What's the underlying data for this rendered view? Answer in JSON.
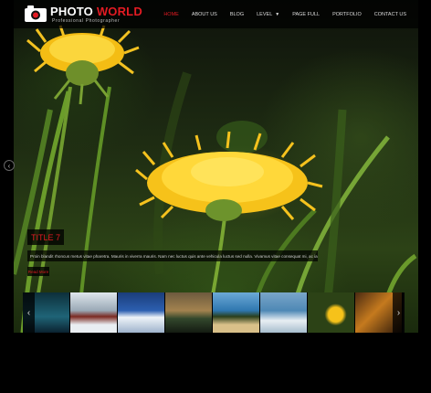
{
  "header": {
    "brand_primary": "PHOTO",
    "brand_accent": "WORLD",
    "tagline": "Professional Photographer",
    "logo_icon": "camera-icon"
  },
  "nav": {
    "items": [
      {
        "label": "HOME",
        "active": true
      },
      {
        "label": "ABOUT US",
        "active": false
      },
      {
        "label": "BLOG",
        "active": false
      },
      {
        "label": "LEVEL",
        "active": false,
        "has_submenu": true
      },
      {
        "label": "PAGE FULL",
        "active": false
      },
      {
        "label": "PORTFOLIO",
        "active": false
      },
      {
        "label": "CONTACT US",
        "active": false
      }
    ]
  },
  "slider": {
    "caption_title": "TITLE 7",
    "caption_text": "Proin blandit rhoncus metus vitae pharetra. Mauris in viverra mauris. Nam nec luctus quis ante vehicula luctus sed nulla. Vivamus vitae consequat mi, ac iaculis metus.",
    "button_label": "Read More",
    "prev_icon": "chevron-left-icon",
    "thumb_prev_icon": "chevron-left-icon",
    "thumb_next_icon": "chevron-right-icon"
  },
  "colors": {
    "accent": "#e31b23",
    "topbar": "#000000",
    "dandelion": "#f6c21a"
  }
}
